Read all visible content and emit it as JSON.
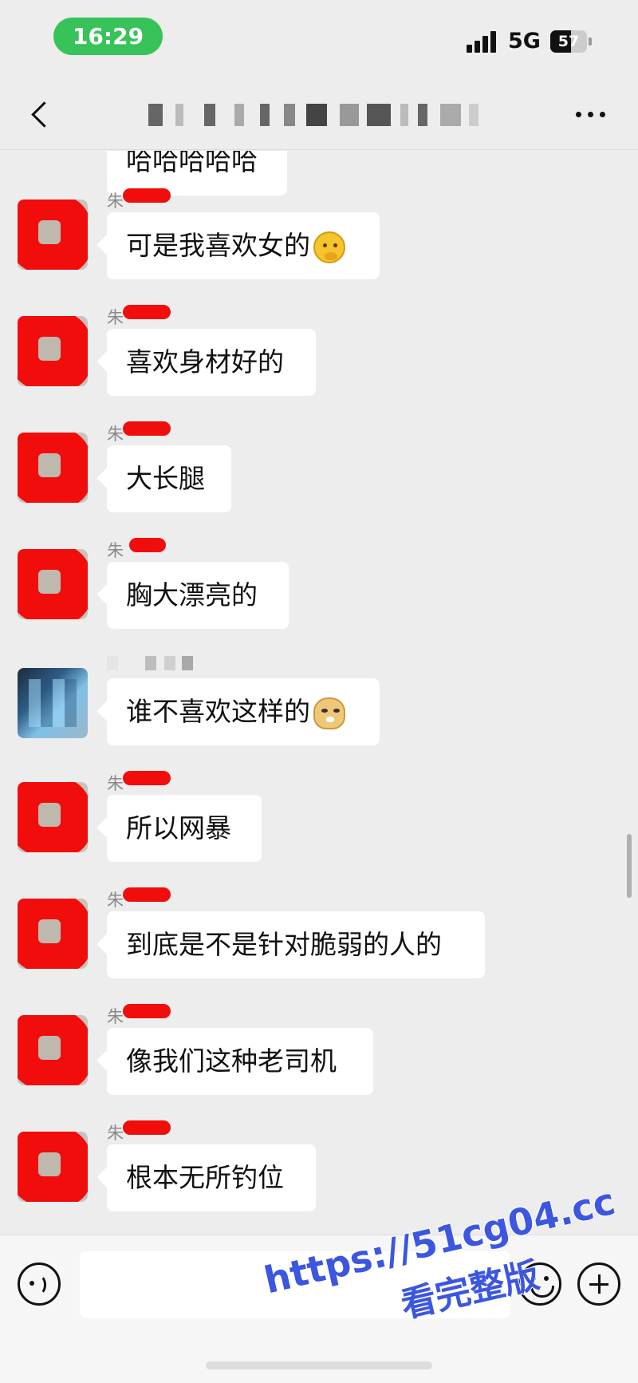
{
  "status_bar": {
    "time": "16:29",
    "network": "5G",
    "battery": "57",
    "battery_level": 0.57
  },
  "header": {
    "title": ""
  },
  "messages": [
    {
      "sender": "朱",
      "text": "可是我喜欢女的",
      "emoji": "thinking-face-emoji"
    },
    {
      "sender": "朱",
      "text": "喜欢身材好的"
    },
    {
      "sender": "朱",
      "text": "大长腿"
    },
    {
      "sender": "朱",
      "text": "胸大漂亮的"
    },
    {
      "sender": "",
      "text": "谁不喜欢这样的",
      "emoji": "doge-emoji"
    },
    {
      "sender": "朱",
      "text": "所以网暴"
    },
    {
      "sender": "朱",
      "text": "到底是不是针对脆弱的人的"
    },
    {
      "sender": "朱",
      "text": "像我们这种老司机"
    },
    {
      "sender": "朱",
      "text": "根本无所钓位"
    }
  ],
  "partial_message": {
    "text": "哈哈哈哈哈"
  },
  "input_bar": {
    "value": "",
    "placeholder": ""
  },
  "watermark": {
    "url": "https://51cg04.cc",
    "text": "看完整版"
  },
  "colors": {
    "background": "#ededed",
    "status_pill": "#38c25a",
    "redaction": "#f20d0d",
    "watermark": "#3c56e0"
  }
}
